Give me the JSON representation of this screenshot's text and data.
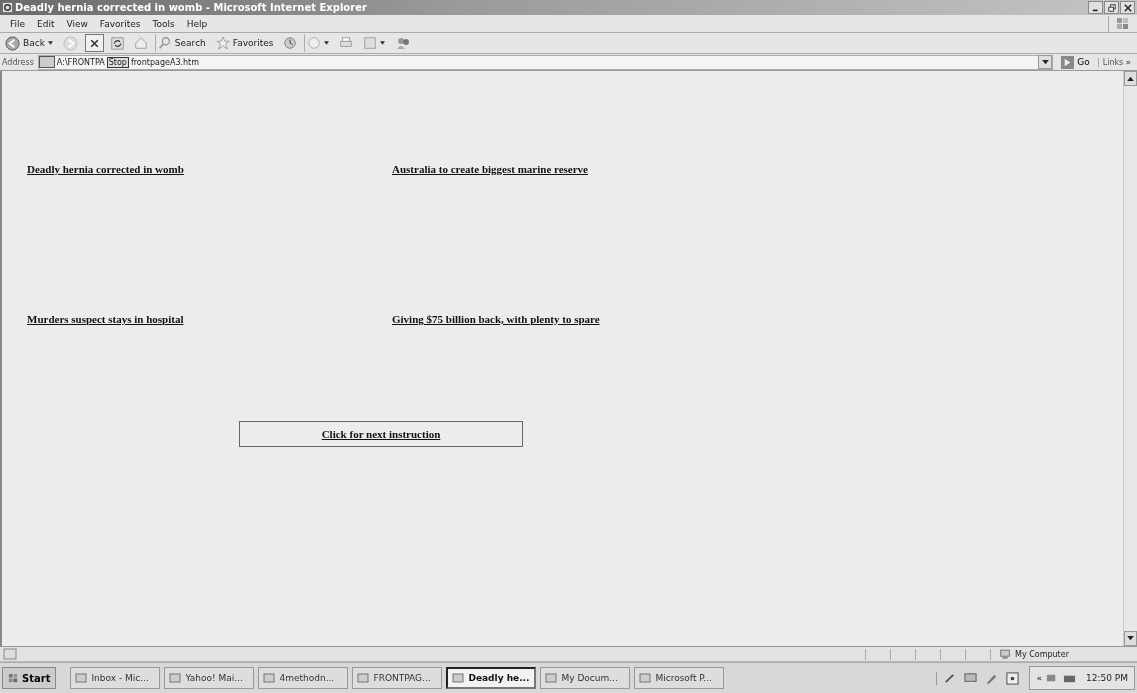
{
  "window": {
    "title": "Deadly hernia corrected in womb - Microsoft Internet Explorer"
  },
  "menu": [
    "File",
    "Edit",
    "View",
    "Favorites",
    "Tools",
    "Help"
  ],
  "toolbar": [
    {
      "kind": "back",
      "label": "Back"
    },
    {
      "kind": "forward"
    },
    {
      "kind": "stop"
    },
    {
      "kind": "refresh"
    },
    {
      "kind": "home"
    },
    {
      "kind": "search",
      "label": "Search"
    },
    {
      "kind": "favorites",
      "label": "Favorites"
    },
    {
      "kind": "history"
    },
    {
      "kind": "mail"
    },
    {
      "kind": "print"
    },
    {
      "kind": "edit"
    },
    {
      "kind": "messenger"
    }
  ],
  "address": {
    "label": "Address",
    "value_start": "A:\\FRONTPA",
    "tooltip": "Stop",
    "value_end": "frontpageA3.htm",
    "go": "Go",
    "links": "Links",
    "more": "»"
  },
  "links": [
    "Deadly hernia corrected in womb",
    "Australia to create biggest marine  reserve",
    "Murders suspect stays in hospital",
    "Giving $75 billion back, with plenty to spare"
  ],
  "next_button": "Click for next instruction",
  "status_bar": {
    "zone": "My Computer"
  },
  "taskbar": {
    "start": "Start",
    "items": [
      {
        "label": "Inbox - Mic...",
        "selected": false
      },
      {
        "label": "Yahoo! Mai...",
        "selected": false
      },
      {
        "label": "4methodn...",
        "selected": false
      },
      {
        "label": "FRONTPAG...",
        "selected": false
      },
      {
        "label": "Deadly he...",
        "selected": true
      },
      {
        "label": "My Docum...",
        "selected": false
      },
      {
        "label": "Microsoft P...",
        "selected": false
      }
    ],
    "tray_expand": "«",
    "time": "12:50 PM"
  }
}
